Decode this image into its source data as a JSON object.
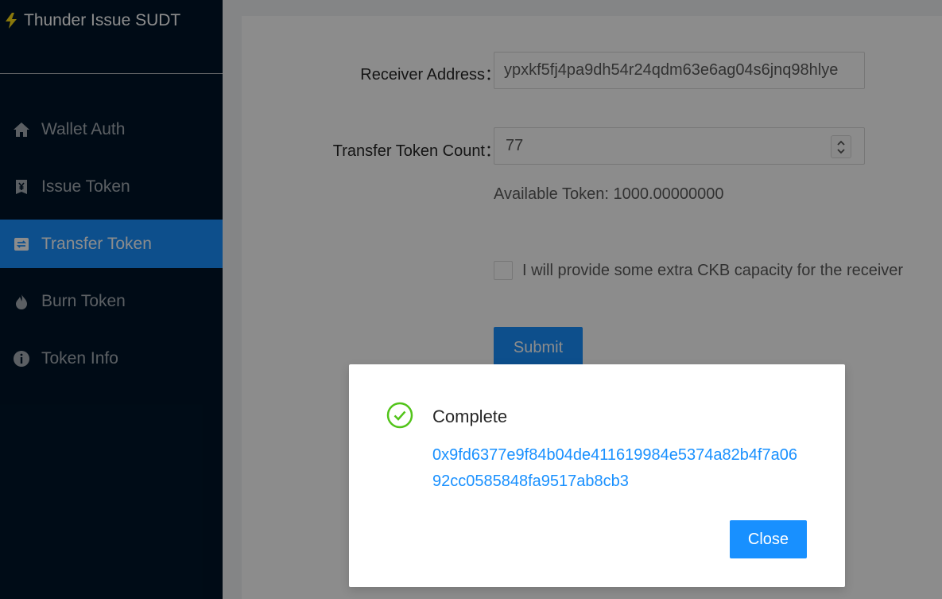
{
  "app": {
    "title": "Thunder Issue SUDT"
  },
  "sidebar": {
    "items": [
      {
        "label": "Wallet Auth",
        "icon": "home-icon",
        "active": false
      },
      {
        "label": "Issue Token",
        "icon": "yuan-icon",
        "active": false
      },
      {
        "label": "Transfer Token",
        "icon": "transfer-icon",
        "active": true
      },
      {
        "label": "Burn Token",
        "icon": "fire-icon",
        "active": false
      },
      {
        "label": "Token Info",
        "icon": "info-icon",
        "active": false
      }
    ]
  },
  "form": {
    "receiver_label": "Receiver Address",
    "receiver_value": "ypxkf5fj4pa9dh54r24qdm63e6ag04s6jnq98hlye",
    "count_label": "Transfer Token Count",
    "count_value": "77",
    "available_text": "Available Token: 1000.00000000",
    "extra_ckb_label": "I will provide some extra CKB capacity for the receiver",
    "submit_label": "Submit"
  },
  "modal": {
    "title": "Complete",
    "tx_hash": "0x9fd6377e9f84b04de411619984e5374a82b4f7a0692cc0585848fa9517ab8cb3",
    "close_label": "Close",
    "icon": "check-circle-icon"
  },
  "colors": {
    "sidebar_bg": "#001529",
    "accent": "#1890ff",
    "success": "#52c41a"
  }
}
